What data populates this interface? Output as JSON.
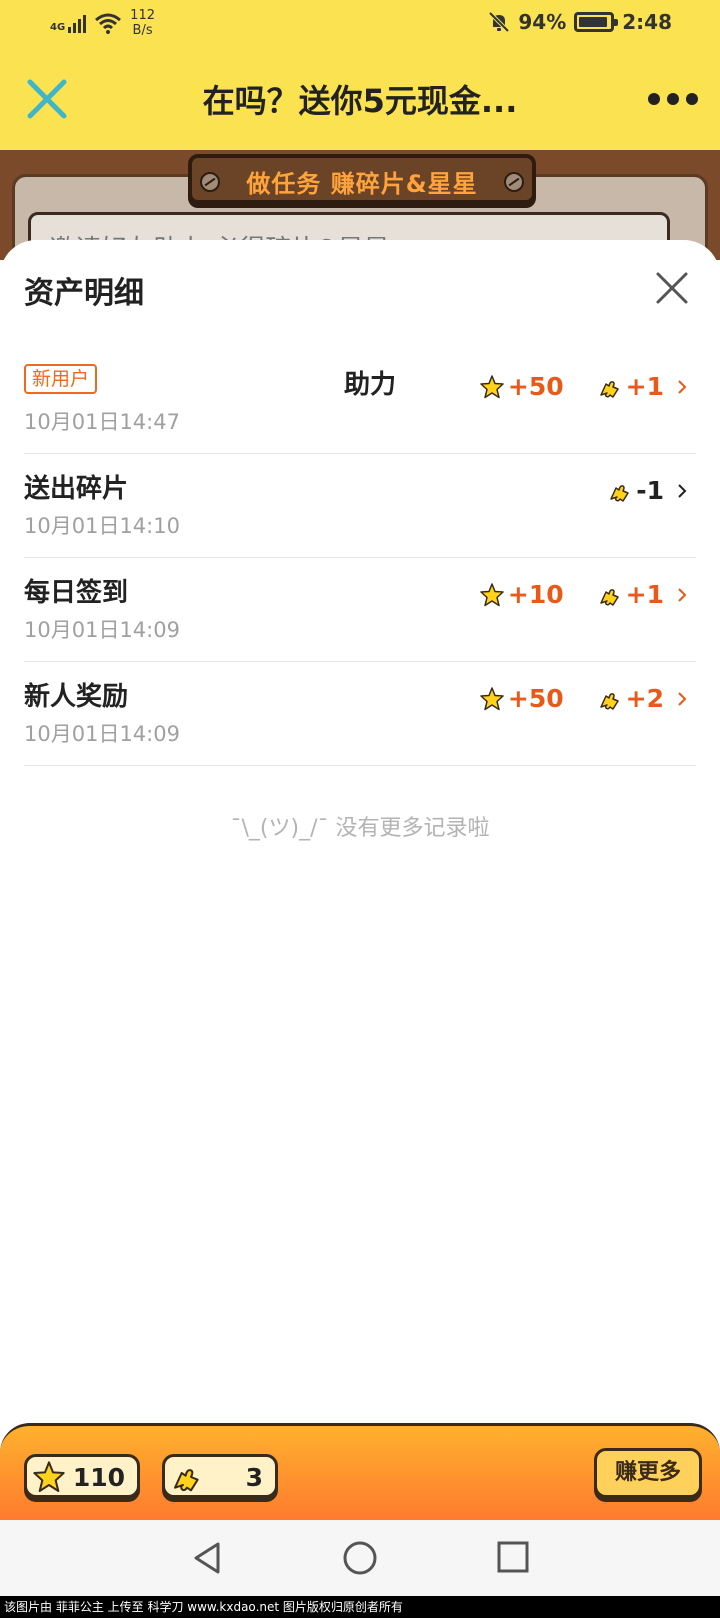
{
  "status_bar": {
    "network": "4G",
    "speed_value": "112",
    "speed_unit": "B/s",
    "battery": "94%",
    "time": "2:48"
  },
  "header": {
    "title": "在吗？送你5元现金...",
    "close_icon": "close-icon",
    "more_icon": "more-dots-icon"
  },
  "background": {
    "banner": "做任务 赚碎片&星星",
    "task_text": "邀请好友助力 必得碎片&星星"
  },
  "sheet": {
    "title": "资产明细",
    "records": [
      {
        "badge": "新用户",
        "title": "助力",
        "time": "10月01日14:47",
        "stars": "+50",
        "pieces": "+1"
      },
      {
        "title": "送出碎片",
        "time": "10月01日14:10",
        "pieces": "-1"
      },
      {
        "title": "每日签到",
        "time": "10月01日14:09",
        "stars": "+10",
        "pieces": "+1"
      },
      {
        "title": "新人奖励",
        "time": "10月01日14:09",
        "stars": "+50",
        "pieces": "+2"
      }
    ],
    "empty_note": "¯\\_(ツ)_/¯ 没有更多记录啦"
  },
  "bottom_bar": {
    "stars_total": "110",
    "pieces_total": "3",
    "earn_more": "赚更多"
  },
  "watermark": "该图片由 菲菲公主 上传至 科学刀 www.kxdao.net 图片版权归原创者所有",
  "colors": {
    "header_yellow": "#fbe251",
    "accent_orange": "#e8591a",
    "star_yellow": "#ffd21c"
  }
}
